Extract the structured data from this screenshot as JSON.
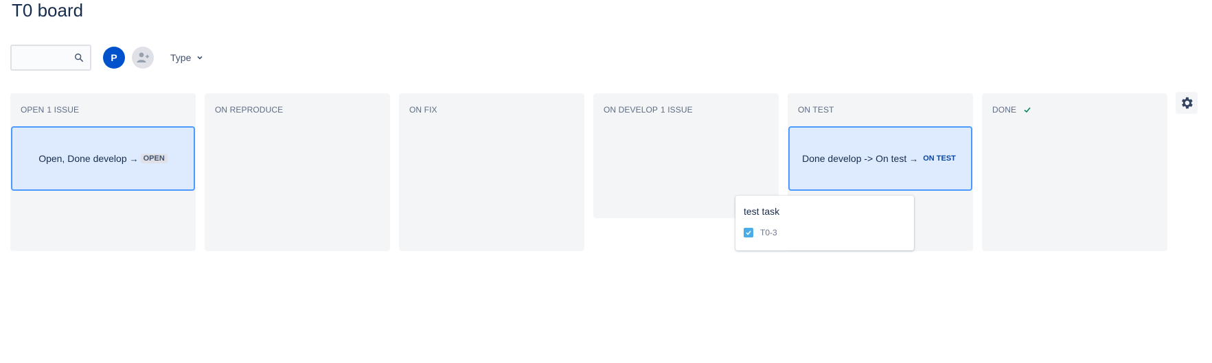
{
  "page": {
    "title": "T0 board"
  },
  "toolbar": {
    "search_placeholder": "",
    "search_icon": "search-icon",
    "avatar_initial": "P",
    "avatar_color": "#0052cc",
    "add_person_icon": "add-person-icon",
    "type_filter_label": "Type",
    "type_filter_icon": "chevron-down-icon"
  },
  "columns": [
    {
      "title": "OPEN",
      "count": "1 ISSUE"
    },
    {
      "title": "ON REPRODUCE",
      "count": ""
    },
    {
      "title": "ON FIX",
      "count": ""
    },
    {
      "title": "ON DEVELOP",
      "count": "1 ISSUE"
    },
    {
      "title": "ON TEST",
      "count": ""
    },
    {
      "title": "DONE",
      "count": "",
      "done_icon": "check-icon"
    }
  ],
  "cards": [
    {
      "text": "Open, Done develop",
      "arrow": "→",
      "status": "OPEN"
    },
    {
      "text": "Done develop -> On test",
      "arrow": "→",
      "status": "ON TEST"
    }
  ],
  "popup": {
    "title": "test task",
    "issue_key": "T0-3",
    "type_icon": "checkbox-task-icon"
  },
  "settings_icon": "gear-icon",
  "colors": {
    "column_bg": "#f4f5f7",
    "card_bg": "#deebff",
    "card_border": "#4c9aff",
    "primary": "#0052cc",
    "done_check": "#00875a"
  }
}
